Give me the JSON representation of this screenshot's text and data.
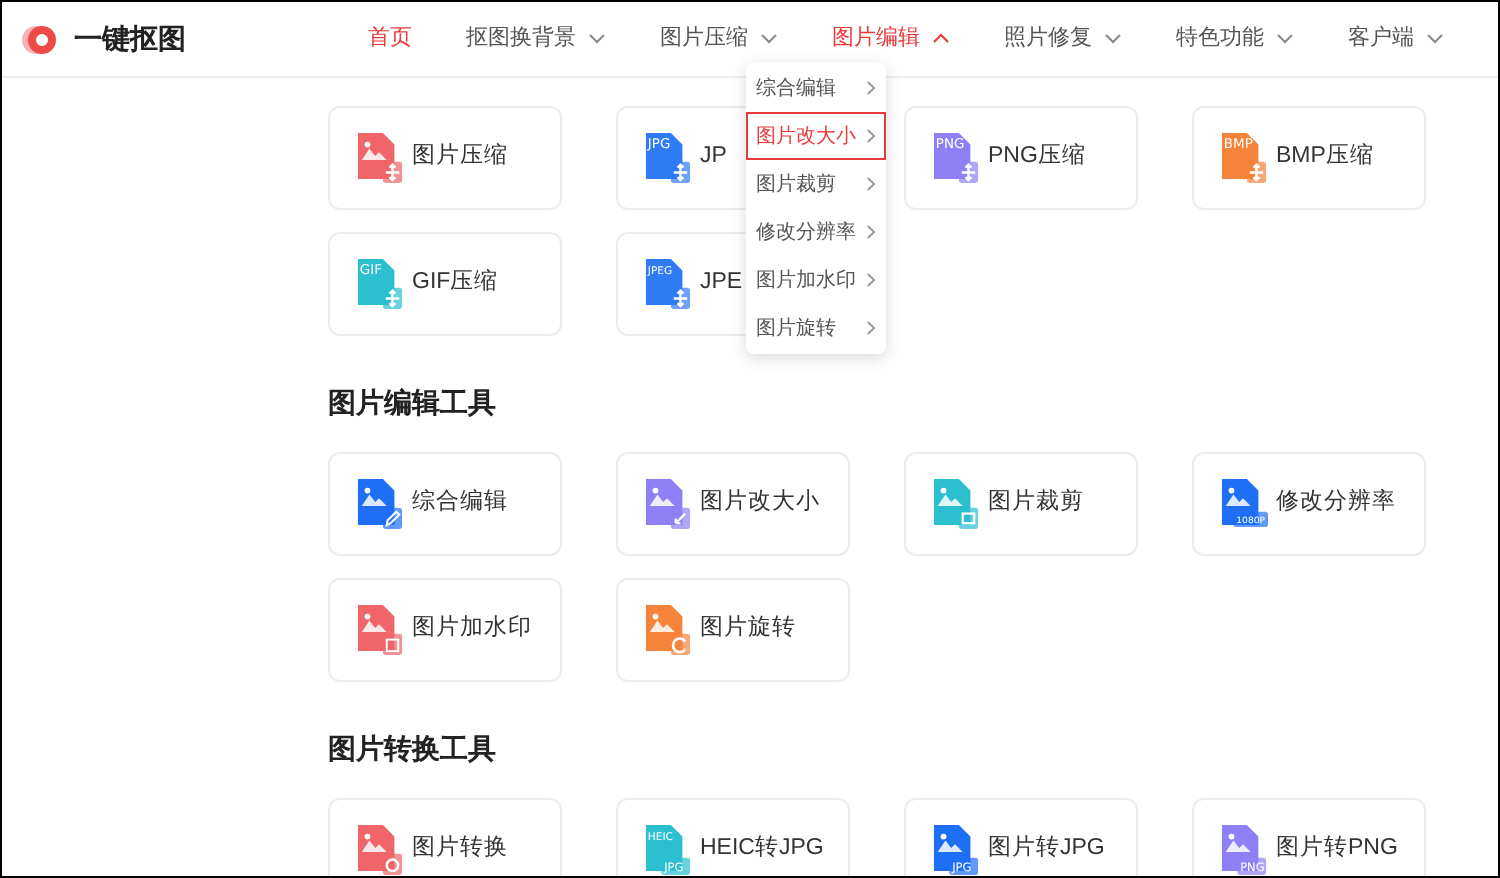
{
  "logo": {
    "text": "一键抠图"
  },
  "nav": [
    {
      "label": "首页",
      "selected": true
    },
    {
      "label": "抠图换背景",
      "selected": false,
      "expanded": false
    },
    {
      "label": "图片压缩",
      "selected": false,
      "expanded": false
    },
    {
      "label": "图片编辑",
      "selected": true,
      "expanded": true
    },
    {
      "label": "照片修复",
      "selected": false,
      "expanded": false
    },
    {
      "label": "特色功能",
      "selected": false,
      "expanded": false
    },
    {
      "label": "客户端",
      "selected": false,
      "expanded": false
    }
  ],
  "dropdown": {
    "items": [
      {
        "label": "综合编辑",
        "selected": false
      },
      {
        "label": "图片改大小",
        "selected": true
      },
      {
        "label": "图片裁剪",
        "selected": false
      },
      {
        "label": "修改分辨率",
        "selected": false
      },
      {
        "label": "图片加水印",
        "selected": false
      },
      {
        "label": "图片旋转",
        "selected": false
      }
    ]
  },
  "sections": [
    {
      "cards": [
        {
          "label": "图片压缩",
          "icon": {
            "kind": "compress",
            "color": "#f0656a"
          }
        },
        {
          "label": "JP",
          "icon": {
            "kind": "compress",
            "color": "#2f7bf5",
            "badge": "JPG"
          }
        },
        {
          "label": "PNG压缩",
          "icon": {
            "kind": "compress",
            "color": "#8f80f7",
            "badge": "PNG"
          }
        },
        {
          "label": "BMP压缩",
          "icon": {
            "kind": "compress",
            "color": "#f5843a",
            "badge": "BMP"
          }
        },
        {
          "label": "GIF压缩",
          "icon": {
            "kind": "compress",
            "color": "#2bbfd0",
            "badge": "GIF"
          }
        },
        {
          "label": "JPE",
          "icon": {
            "kind": "compress",
            "color": "#2f7bf5",
            "badge": "JPEG"
          }
        }
      ]
    },
    {
      "title": "图片编辑工具",
      "cards": [
        {
          "label": "综合编辑",
          "icon": {
            "kind": "edit",
            "color": "#1e6ff5"
          }
        },
        {
          "label": "图片改大小",
          "icon": {
            "kind": "resize",
            "color": "#8f80f7"
          }
        },
        {
          "label": "图片裁剪",
          "icon": {
            "kind": "crop",
            "color": "#2bbfd0"
          }
        },
        {
          "label": "修改分辨率",
          "icon": {
            "kind": "resolution",
            "color": "#1e6ff5",
            "badge": "1080P"
          }
        },
        {
          "label": "图片加水印",
          "icon": {
            "kind": "watermark",
            "color": "#f0656a"
          }
        },
        {
          "label": "图片旋转",
          "icon": {
            "kind": "rotate",
            "color": "#f5843a"
          }
        }
      ]
    },
    {
      "title": "图片转换工具",
      "cards": [
        {
          "label": "图片转换",
          "icon": {
            "kind": "convert",
            "color": "#f0656a"
          }
        },
        {
          "label": "HEIC转JPG",
          "icon": {
            "kind": "format",
            "color": "#2bbfd0",
            "badge": "HEIC",
            "sub": "JPG"
          }
        },
        {
          "label": "图片转JPG",
          "icon": {
            "kind": "format",
            "color": "#1e6ff5",
            "sub": "JPG"
          }
        },
        {
          "label": "图片转PNG",
          "icon": {
            "kind": "format",
            "color": "#8f80f7",
            "sub": "PNG"
          }
        }
      ]
    }
  ]
}
